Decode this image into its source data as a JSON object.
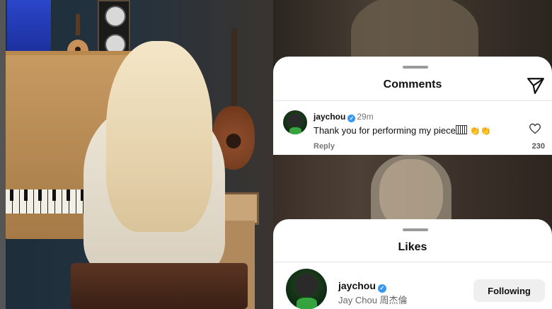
{
  "comments_sheet": {
    "title": "Comments",
    "comment": {
      "username": "jaychou",
      "time": "29m",
      "text": "Thank you for performing my piece",
      "reply_label": "Reply",
      "like_count": "230"
    },
    "icons": [
      "send-icon",
      "verified-badge-icon",
      "piano-emoji",
      "clapping-hands-emoji",
      "heart-icon"
    ]
  },
  "likes_sheet": {
    "title": "Likes",
    "user": {
      "username": "jaychou",
      "full_name": "Jay Chou 周杰倫",
      "button_label": "Following"
    }
  },
  "colors": {
    "verified": "#3897f0",
    "sheet_bg": "#ffffff",
    "button_bg": "#efefef"
  }
}
